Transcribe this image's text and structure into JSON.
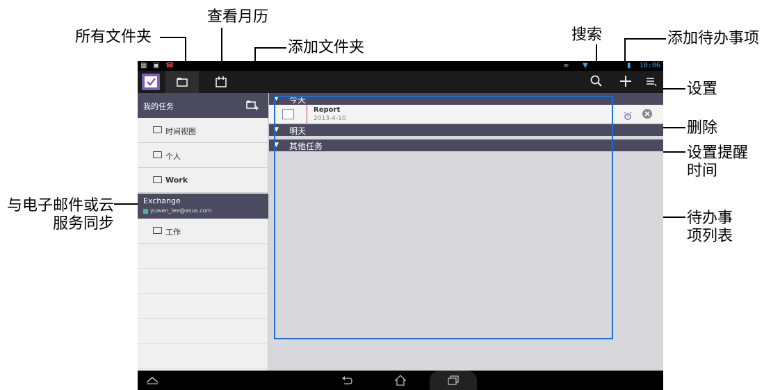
{
  "callouts": {
    "all_folders": "所有文件夹",
    "view_calendar": "查看月历",
    "add_folder": "添加文件夹",
    "search": "搜索",
    "add_todo": "添加待办事项",
    "settings": "设置",
    "delete": "删除",
    "set_reminder": "设置提醒时间",
    "sync": "与电子邮件或云服务同步",
    "todo_list": "待办事项列表"
  },
  "status_bar": {
    "time": "10:06"
  },
  "sidebar": {
    "header": "我的任务",
    "items": [
      {
        "label": "时间视图"
      },
      {
        "label": "个人"
      },
      {
        "label": "Work"
      }
    ],
    "account": {
      "name": "Exchange",
      "email": "yuwen_lee@asus.com"
    },
    "account_items": [
      {
        "label": "工作"
      }
    ]
  },
  "main": {
    "groups": [
      {
        "label": "今天"
      },
      {
        "label": "明天"
      },
      {
        "label": "其他任务"
      }
    ],
    "task": {
      "title": "Report",
      "date": "2013-4-10"
    }
  },
  "colors": {
    "header_bg": "#4c4a5e",
    "callout_box": "#1a6fd6",
    "accent_blue": "#3aa3f0",
    "app_icon": "#7a5fb5"
  }
}
